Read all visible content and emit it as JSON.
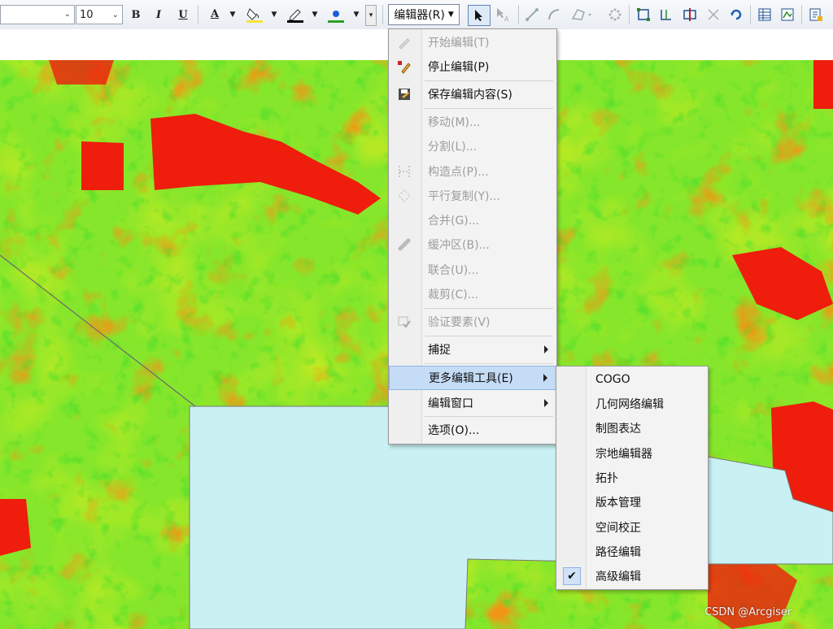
{
  "toolbar": {
    "font_size": "10",
    "bold_label": "B",
    "italic_label": "I",
    "underline_label": "U",
    "font_color_label": "A",
    "editor_button_label": "编辑器(R)",
    "colors": {
      "font": "#000000",
      "fill": "#f7e23a",
      "line": "#000000",
      "marker": "#2aa02a",
      "marker_outline": "#1c5bd6"
    }
  },
  "editor_menu": {
    "items": [
      {
        "label": "开始编辑(T)",
        "enabled": false
      },
      {
        "label": "停止编辑(P)",
        "enabled": true
      },
      {
        "label": "保存编辑内容(S)",
        "enabled": true
      },
      {
        "label": "移动(M)...",
        "enabled": false
      },
      {
        "label": "分割(L)...",
        "enabled": false
      },
      {
        "label": "构造点(P)...",
        "enabled": false
      },
      {
        "label": "平行复制(Y)...",
        "enabled": false
      },
      {
        "label": "合并(G)...",
        "enabled": false
      },
      {
        "label": "缓冲区(B)...",
        "enabled": false
      },
      {
        "label": "联合(U)...",
        "enabled": false
      },
      {
        "label": "裁剪(C)...",
        "enabled": false
      },
      {
        "label": "验证要素(V)",
        "enabled": false
      },
      {
        "label": "捕捉",
        "enabled": true
      },
      {
        "label": "更多编辑工具(E)",
        "enabled": true,
        "highlighted": true
      },
      {
        "label": "编辑窗口",
        "enabled": true
      },
      {
        "label": "选项(O)...",
        "enabled": true
      }
    ]
  },
  "more_tools_menu": {
    "items": [
      {
        "label": "COGO"
      },
      {
        "label": "几何网络编辑"
      },
      {
        "label": "制图表达"
      },
      {
        "label": "宗地编辑器"
      },
      {
        "label": "拓扑"
      },
      {
        "label": "版本管理"
      },
      {
        "label": "空间校正"
      },
      {
        "label": "路径编辑"
      },
      {
        "label": "高级编辑",
        "checked": true
      }
    ],
    "check_mark": "✔"
  },
  "map": {
    "colors": {
      "vegetation_green": "#7fe62e",
      "bright_green": "#3fdc2a",
      "yellow": "#e6ee1e",
      "orange": "#ff8a12",
      "red": "#f01a0a",
      "water": "#c9f1f3"
    }
  },
  "watermark": "CSDN @Arcgiser"
}
